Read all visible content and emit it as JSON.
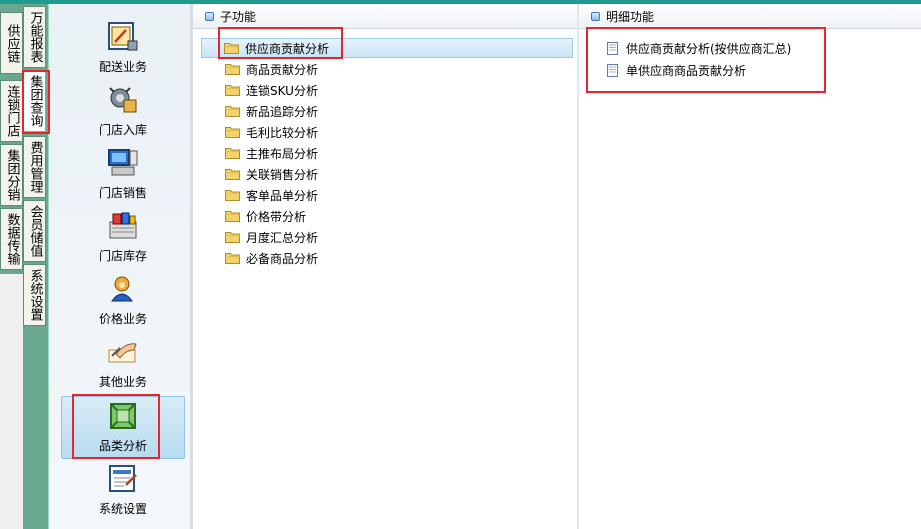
{
  "outer_tabs": {
    "col1": [
      "供应链",
      "连锁门店",
      "集团分销",
      "数据传输"
    ],
    "col2": [
      "万能报表",
      "集团查询",
      "费用管理",
      "会员储值",
      "系统设置"
    ],
    "selected": "集团查询"
  },
  "modules": [
    {
      "label": "配送业务",
      "icon": "delivery-icon"
    },
    {
      "label": "门店入库",
      "icon": "warehouse-gear-icon"
    },
    {
      "label": "门店销售",
      "icon": "pos-terminal-icon"
    },
    {
      "label": "门店库存",
      "icon": "inventory-box-icon"
    },
    {
      "label": "价格业务",
      "icon": "person-price-icon"
    },
    {
      "label": "其他业务",
      "icon": "hand-writing-icon"
    },
    {
      "label": "品类分析",
      "icon": "category-analysis-icon"
    },
    {
      "label": "系统设置",
      "icon": "settings-form-icon"
    }
  ],
  "selected_module": "品类分析",
  "subfunctions": {
    "title": "子功能",
    "items": [
      "供应商贡献分析",
      "商品贡献分析",
      "连锁SKU分析",
      "新品追踪分析",
      "毛利比较分析",
      "主推布局分析",
      "关联销售分析",
      "客单品单分析",
      "价格带分析",
      "月度汇总分析",
      "必备商品分析"
    ],
    "selected": "供应商贡献分析"
  },
  "details": {
    "title": "明细功能",
    "items": [
      "供应商贡献分析(按供应商汇总)",
      "单供应商商品贡献分析"
    ]
  },
  "colors": {
    "highlight_box": "#e8252a",
    "top_bar": "#1f9b8f",
    "folder": "#f2d36b"
  }
}
